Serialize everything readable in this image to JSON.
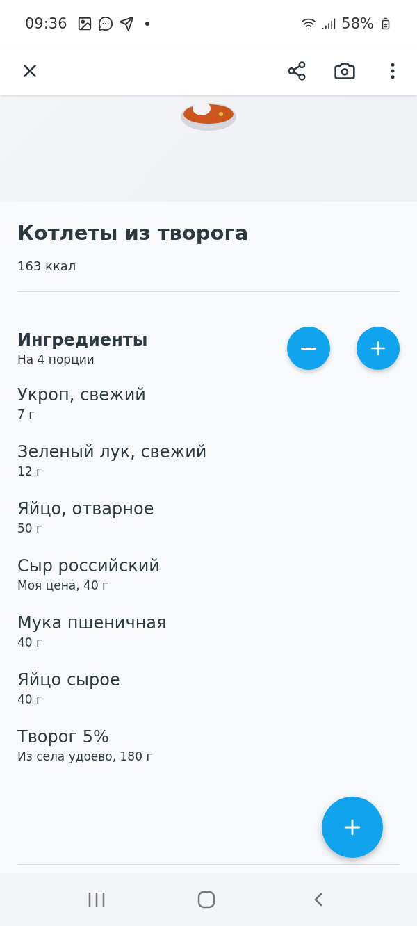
{
  "status_bar": {
    "time": "09:36",
    "battery": "58%"
  },
  "recipe": {
    "title": "Котлеты из творога",
    "calories": "163 ккал"
  },
  "ingredients": {
    "title": "Ингредиенты",
    "servings": "На 4 порции",
    "items": [
      {
        "name": "Укроп, свежий",
        "detail": "7 г"
      },
      {
        "name": "Зеленый лук, свежий",
        "detail": "12 г"
      },
      {
        "name": "Яйцо, отварное",
        "detail": "50 г"
      },
      {
        "name": "Сыр российский",
        "detail": "Моя цена, 40 г"
      },
      {
        "name": "Мука пшеничная",
        "detail": "40 г"
      },
      {
        "name": "Яйцо сырое",
        "detail": "40 г"
      },
      {
        "name": "Творог 5%",
        "detail": "Из села удоево, 180 г"
      }
    ]
  }
}
